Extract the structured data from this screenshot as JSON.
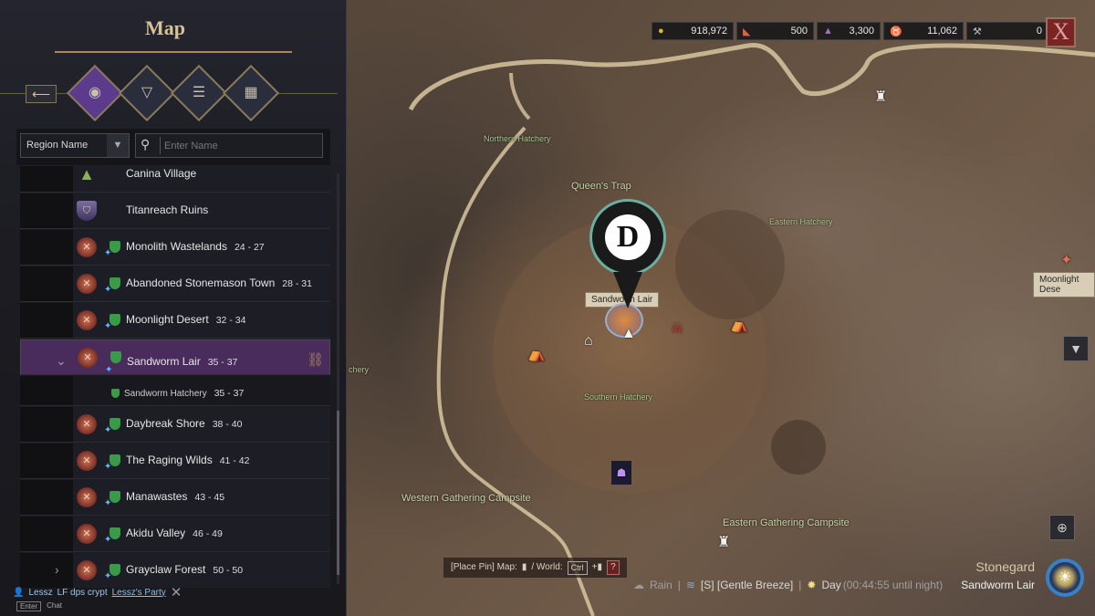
{
  "panel": {
    "title": "Map",
    "back_icon": "arrow-left-icon",
    "tabs": [
      {
        "icon": "compass-icon",
        "active": true
      },
      {
        "icon": "triangle-marker-icon"
      },
      {
        "icon": "sliders-icon"
      },
      {
        "icon": "calendar-icon"
      }
    ],
    "filter": {
      "select_value": "Region Name",
      "search_placeholder": "Enter Name"
    }
  },
  "regions": [
    {
      "name": "Canina Village",
      "level": "",
      "type": "village"
    },
    {
      "name": "Titanreach Ruins",
      "level": "",
      "type": "ruin"
    },
    {
      "name": "Monolith Wastelands",
      "level": "24 - 27"
    },
    {
      "name": "Abandoned Stonemason Town",
      "level": "28 - 31"
    },
    {
      "name": "Moonlight Desert",
      "level": "32 - 34"
    },
    {
      "name": "Sandworm Lair",
      "level": "35 - 37",
      "selected": true,
      "expanded": true
    },
    {
      "name": "Sandworm Hatchery",
      "level": "35 - 37",
      "sub": true
    },
    {
      "name": "Daybreak Shore",
      "level": "38 - 40"
    },
    {
      "name": "The Raging Wilds",
      "level": "41 - 42"
    },
    {
      "name": "Manawastes",
      "level": "43 - 45"
    },
    {
      "name": "Akidu Valley",
      "level": "46 - 49"
    },
    {
      "name": "Grayclaw Forest",
      "level": "50 - 50",
      "collapsed": true
    }
  ],
  "currencies": [
    {
      "icon": "gold-coin-icon",
      "value": "918,972"
    },
    {
      "icon": "ticket-icon",
      "value": "500"
    },
    {
      "icon": "hooded-figure-icon",
      "value": "3,300"
    },
    {
      "icon": "demon-head-icon",
      "value": "11,062"
    },
    {
      "icon": "pickaxe-icon",
      "value": "0"
    }
  ],
  "map": {
    "labels": {
      "northern": "Northern Hatchery",
      "queens": "Queen's Trap",
      "eastern": "Eastern Hatchery",
      "southern": "Southern Hatchery",
      "west_edge": "chery",
      "western_camp": "Western Gathering Campsite",
      "eastern_camp": "Eastern Gathering Campsite"
    },
    "pin_tag": "Sandworm Lair",
    "pin_letter": "D",
    "edge_tag": "Moonlight Dese"
  },
  "hint": {
    "place_pin": "[Place Pin] Map:",
    "world": "/ World:",
    "ctrl": "Ctrl",
    "help": "?"
  },
  "weather": {
    "rain": "Rain",
    "wind": "[S] [Gentle Breeze]",
    "day": "Day",
    "time": "(00:44:55 until night)"
  },
  "location": {
    "area": "Stonegard",
    "region": "Sandworm Lair"
  },
  "chat": {
    "user": "Lessz",
    "message": "LF dps crypt",
    "party": "Lessz's Party",
    "enter": "Enter",
    "chat": "Chat"
  }
}
